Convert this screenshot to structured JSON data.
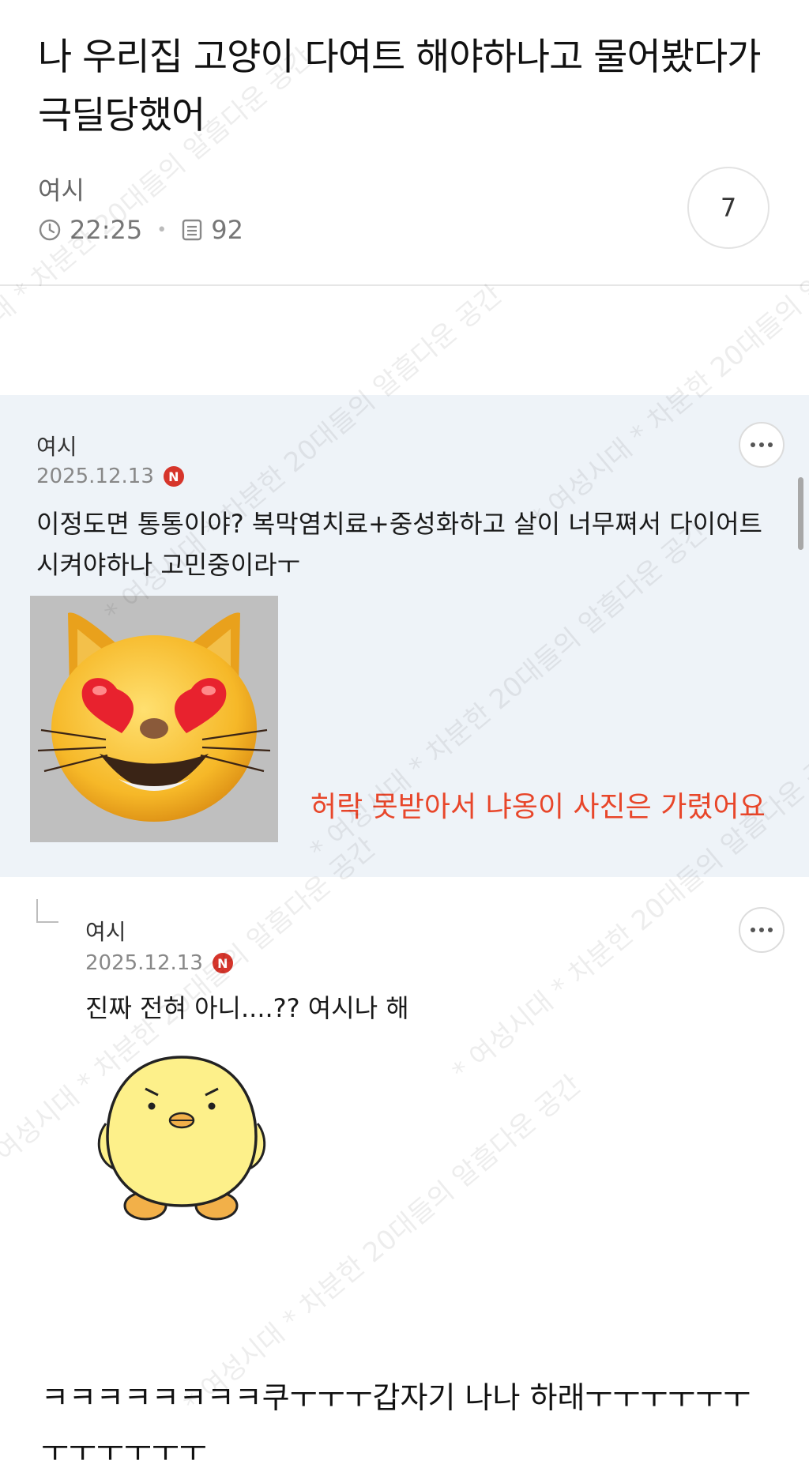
{
  "post": {
    "title": "나 우리집 고양이 다여트 해야하나고 물어봤다가 극딜당했어",
    "author": "여시",
    "time": "22:25",
    "views": "92",
    "comment_count": "7"
  },
  "comments": [
    {
      "author": "여시",
      "date": "2025.12.13",
      "badge": "N",
      "text": "이정도면 통통이야? 복막염치료+중성화하고 살이 너무쪄서 다이어트 시켜야하나 고민중이라ㅜ",
      "image_icon": "heart-eyes-cat-emoji",
      "note": "허락 못받아서 냐옹이 사진은 가렸어요",
      "note_color": "#e8462a"
    },
    {
      "author": "여시",
      "date": "2025.12.13",
      "badge": "N",
      "text": "진짜 전혀 아니....?? 여시나 해",
      "image_icon": "angry-chick-sticker"
    }
  ],
  "caption": "ㅋㅋㅋㅋㅋㅋㅋㅋ쿠ㅜㅜㅜ갑자기 나나 하래ㅜㅜㅜㅜㅜㅜㅜㅜㅜㅜㅜㅜ",
  "watermark": "* 여성시대 * 차분한 20대들의 알흠다운 공간",
  "colors": {
    "comment_bg": "#eef3f8",
    "badge_red": "#d6352b"
  }
}
